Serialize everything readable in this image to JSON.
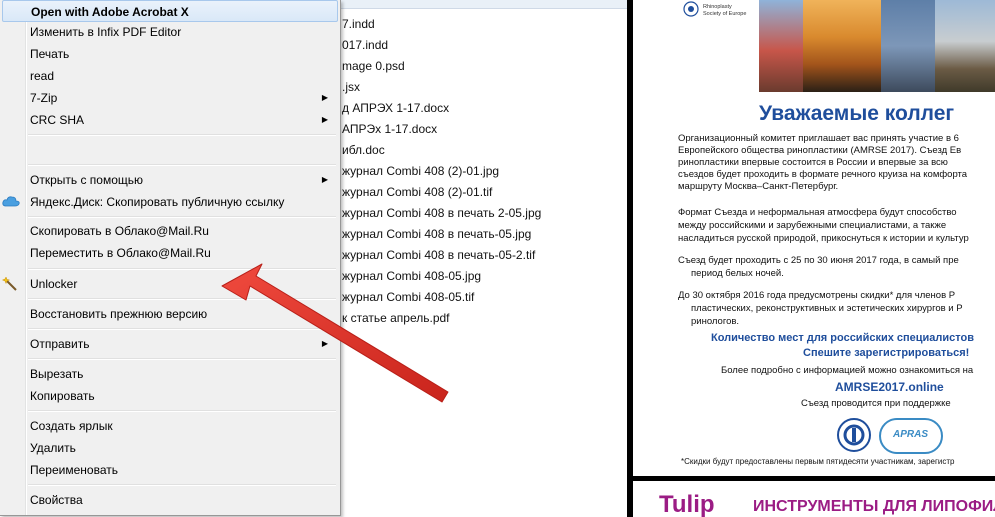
{
  "menu": {
    "items": [
      {
        "label": "Open with Adobe Acrobat X",
        "bold": true
      },
      {
        "label": "Изменить в Infix PDF Editor"
      },
      {
        "label": "Печать"
      },
      {
        "label": "read"
      },
      {
        "label": "7-Zip",
        "submenu": true
      },
      {
        "label": "CRC SHA",
        "submenu": true
      },
      {
        "label": ""
      },
      {
        "label": "Открыть с помощью",
        "submenu": true
      },
      {
        "label": "Яндекс.Диск: Скопировать публичную ссылку"
      },
      {
        "label": "Скопировать в Облако@Mail.Ru"
      },
      {
        "label": "Переместить в Облако@Mail.Ru"
      },
      {
        "label": "Unlocker"
      },
      {
        "label": "Восстановить прежнюю версию"
      },
      {
        "label": "Отправить",
        "submenu": true
      },
      {
        "label": "Вырезать"
      },
      {
        "label": "Копировать"
      },
      {
        "label": "Создать ярлык"
      },
      {
        "label": "Удалить"
      },
      {
        "label": "Переименовать"
      },
      {
        "label": "Свойства"
      }
    ],
    "submenu_arrow": "▶"
  },
  "files": [
    "7.indd",
    "017.indd",
    "mage 0.psd",
    ".jsx",
    "д АПРЭХ 1-17.docx",
    "АПРЭх 1-17.docx",
    "ибл.doc",
    "журнал Combi 408 (2)-01.jpg",
    "журнал Combi 408 (2)-01.tif",
    "журнал Combi 408 в печать 2-05.jpg",
    "журнал Combi 408 в печать-05.jpg",
    "журнал Combi 408 в печать-05-2.tif",
    "журнал Combi 408-05.jpg",
    "журнал Combi 408-05.tif",
    "к статье апрель.pdf"
  ],
  "preview": {
    "logo_text": "Rhinoplasty\nSociety of Europe",
    "title": "Уважаемые коллег",
    "para1": [
      "Организационный комитет приглашает вас принять участие в 6",
      "Европейского общества ринопластики (AMRSE 2017). Съезд Ев",
      "ринопластики впервые состоится в России и впервые за всю",
      "съездов будет проходить в формате речного круиза на комфорта",
      "маршруту Москва–Санкт-Петербург."
    ],
    "para2": [
      "Формат Съезда и неформальная атмосфера будут способство",
      "между российскими и зарубежными специалистами, а также",
      "насладиться русской природой, прикоснуться к истории и культур"
    ],
    "para3": [
      "Съезд будет проходить с 25  по 30 июня 2017 года, в самый пре",
      "период белых ночей."
    ],
    "para4": [
      "До 30 октября 2016 года предусмотрены скидки* для членов Р",
      "пластических, реконструктивных и эстетических хирургов и Р",
      "ринологов."
    ],
    "blue1": "Количество мест для российских специалистов",
    "blue2": "Спешите зарегистрироваться!",
    "info": "Более подробно с информацией можно ознакомиться на",
    "site": "AMRSE2017.online",
    "support": "Съезд проводится при поддержке",
    "seal_right_text": "APRAS",
    "footnote": "*Скидки будут предоставлены первым пятидесяти участникам, зарегистр",
    "tulip_brand": "Tulip",
    "tulip_tag": "ИНСТРУМЕНТЫ ДЛЯ ЛИПОФИЛ"
  },
  "colors": {
    "menu_bg": "#f0f0f0",
    "title_blue": "#1f4e9c",
    "arrow_red": "#e8322d",
    "tulip_purple": "#9b1c84"
  }
}
